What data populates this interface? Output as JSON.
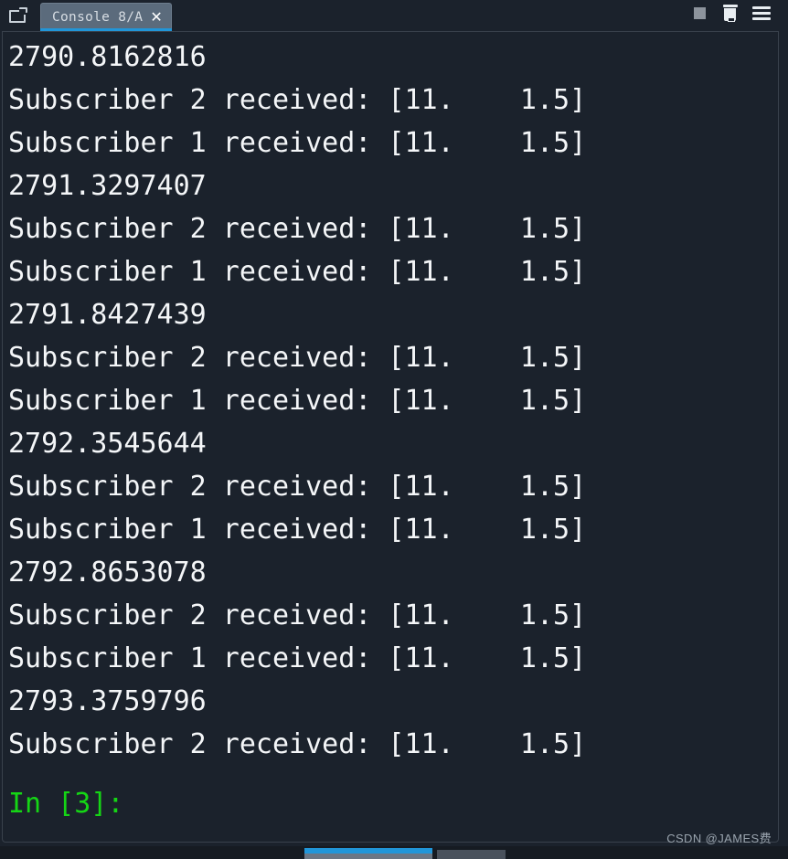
{
  "window": {
    "panel_icon": "panel-window-icon"
  },
  "tab": {
    "label": "Console 8/A",
    "close": "✕"
  },
  "toolbar": {
    "stop_icon": "stop-square-icon",
    "trash_icon": "trash-icon",
    "menu_icon": "hamburger-menu-icon"
  },
  "console": {
    "lines": [
      "2790.8162816",
      "Subscriber 2 received: [11.    1.5]",
      "Subscriber 1 received: [11.    1.5]",
      "2791.3297407",
      "Subscriber 2 received: [11.    1.5]",
      "Subscriber 1 received: [11.    1.5]",
      "2791.8427439",
      "Subscriber 2 received: [11.    1.5]",
      "Subscriber 1 received: [11.    1.5]",
      "2792.3545644",
      "Subscriber 2 received: [11.    1.5]",
      "Subscriber 1 received: [11.    1.5]",
      "2792.8653078",
      "Subscriber 2 received: [11.    1.5]",
      "Subscriber 1 received: [11.    1.5]",
      "2793.3759796",
      "Subscriber 2 received: [11.    1.5]"
    ],
    "prompt": "In [3]:"
  },
  "watermark": "CSDN @JAMES费",
  "colors": {
    "background": "#1b222c",
    "tab_active": "#5b6b7c",
    "tab_underline": "#2196d9",
    "text": "#f4f6f8",
    "prompt_green": "#15d515",
    "taskbar_accent": "#2196d9"
  }
}
